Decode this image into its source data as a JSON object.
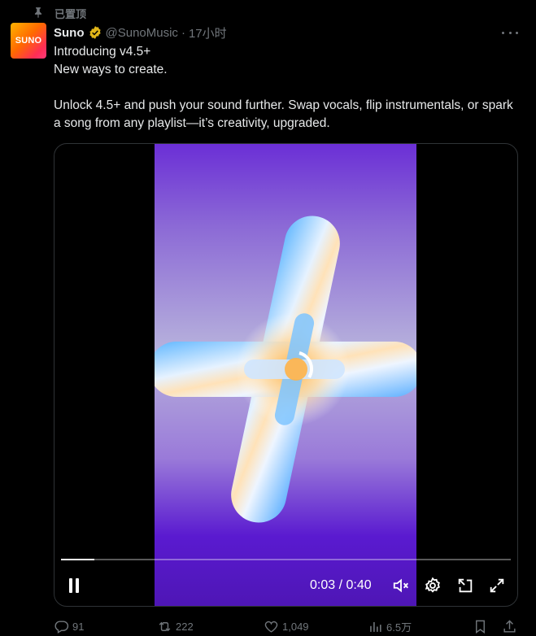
{
  "pinned": {
    "label": "已置顶",
    "icon": "pin-icon"
  },
  "author": {
    "avatar_text": "SUNO",
    "name": "Suno",
    "handle": "@SunoMusic",
    "separator": "·",
    "time": "17小时",
    "verified_color": "#e2b719"
  },
  "tweet": {
    "paragraph1": "Introducing v4.5+\nNew ways to create.",
    "paragraph2": "Unlock 4.5+ and push your sound further. Swap vocals, flip instrumentals, or spark a song from any playlist—it’s creativity, upgraded."
  },
  "video": {
    "time_readout": "0:03 / 0:40",
    "progress": 0.075,
    "icons": [
      "pause-icon",
      "mute-icon",
      "settings-icon",
      "pip-icon",
      "fullscreen-icon"
    ]
  },
  "actions": {
    "replies": "91",
    "reposts": "222",
    "likes": "1,049",
    "views": "6.5万"
  },
  "colors": {
    "background": "#000000",
    "text": "#e7e9ea",
    "muted": "#71767b",
    "border": "#2f3336"
  }
}
